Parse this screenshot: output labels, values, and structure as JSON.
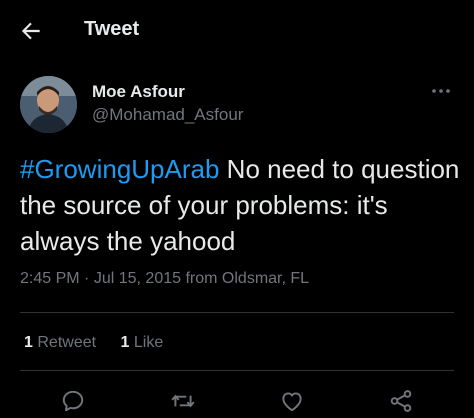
{
  "header": {
    "title": "Tweet",
    "back_icon": "arrow-left-icon"
  },
  "author": {
    "name": "Moe Asfour",
    "handle": "@Mohamad_Asfour"
  },
  "tweet": {
    "hashtag": "#GrowingUpArab",
    "text": " No need to question the source of your problems: it's always the yahood"
  },
  "meta": {
    "time": "2:45 PM",
    "date": "Jul 15, 2015",
    "location": "from Oldsmar, FL"
  },
  "stats": {
    "retweets_count": "1",
    "retweets_label": "Retweet",
    "likes_count": "1",
    "likes_label": "Like"
  },
  "actions": [
    "reply-icon",
    "retweet-icon",
    "like-icon",
    "share-icon"
  ],
  "colors": {
    "background": "#000000",
    "accent": "#1d9bf0",
    "text": "#e7e9ea",
    "muted": "#71767b",
    "divider": "#2f3336"
  }
}
